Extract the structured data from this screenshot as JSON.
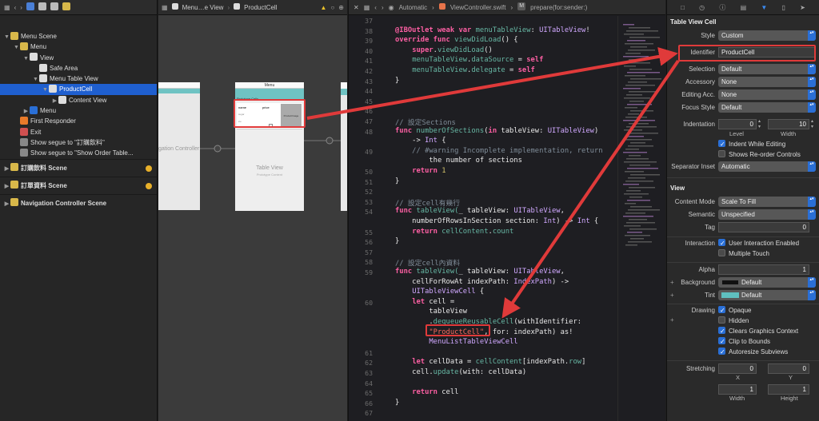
{
  "nav": {
    "tree": [
      {
        "label": "Menu Scene",
        "depth": 0,
        "tri": "▼",
        "icon": "scene-icon"
      },
      {
        "label": "Menu",
        "depth": 1,
        "tri": "▼",
        "icon": "view-controller-icon"
      },
      {
        "label": "View",
        "depth": 2,
        "tri": "▼",
        "icon": "view-icon"
      },
      {
        "label": "Safe Area",
        "depth": 3,
        "tri": "",
        "icon": "safe-area-icon"
      },
      {
        "label": "Menu Table View",
        "depth": 3,
        "tri": "▼",
        "icon": "table-view-icon"
      },
      {
        "label": "ProductCell",
        "depth": 4,
        "tri": "▼",
        "icon": "table-cell-icon",
        "selected": true
      },
      {
        "label": "Content View",
        "depth": 5,
        "tri": "▶",
        "icon": "view-icon"
      },
      {
        "label": "Menu",
        "depth": 2,
        "tri": "▶",
        "icon": "nav-item-icon"
      },
      {
        "label": "First Responder",
        "depth": 1,
        "tri": "",
        "icon": "first-responder-icon"
      },
      {
        "label": "Exit",
        "depth": 1,
        "tri": "",
        "icon": "exit-icon"
      },
      {
        "label": "Show segue to \"訂購飲料\"",
        "depth": 1,
        "tri": "",
        "icon": "segue-icon"
      },
      {
        "label": "Show segue to \"Show Order Table...",
        "depth": 1,
        "tri": "",
        "icon": "segue-icon"
      }
    ],
    "scenes": [
      "訂購飲料 Scene",
      "訂單資料 Scene",
      "Navigation Controller Scene"
    ]
  },
  "jump": {
    "items": [
      "Menu…e View",
      "ProductCell"
    ]
  },
  "canvas": {
    "nav_controller_label": "gation Controller",
    "phone_title": "Menu",
    "prototype_label": "Prototype Cells",
    "cell_name": "name",
    "cell_price": "price",
    "cell_sub1": "sugar",
    "cell_sub2": "ice",
    "cell_image": "ProductImage",
    "table_view_label": "Table View",
    "table_view_sub": "Prototype Content"
  },
  "editor": {
    "breadcrumbs": [
      "Automatic",
      "ViewController.swift",
      "prepare(for:sender:)"
    ],
    "lines": [
      {
        "n": "37",
        "t": ""
      },
      {
        "n": "38",
        "t": "@IBOutlet weak var menuTableView: UITableView!"
      },
      {
        "n": "39",
        "t": "override func viewDidLoad() {"
      },
      {
        "n": "40",
        "t": "    super.viewDidLoad()"
      },
      {
        "n": "41",
        "t": "    menuTableView.dataSource = self"
      },
      {
        "n": "42",
        "t": "    menuTableView.delegate = self"
      },
      {
        "n": "43",
        "t": "}"
      },
      {
        "n": "44",
        "t": ""
      },
      {
        "n": "45",
        "t": ""
      },
      {
        "n": "46",
        "t": ""
      },
      {
        "n": "47",
        "t": "// 設定Sections"
      },
      {
        "n": "48",
        "t": "func numberOfSections(in tableView: UITableView)"
      },
      {
        "n": "",
        "t": "    -> Int {"
      },
      {
        "n": "49",
        "t": "    // #warning Incomplete implementation, return"
      },
      {
        "n": "",
        "t": "        the number of sections"
      },
      {
        "n": "50",
        "t": "    return 1"
      },
      {
        "n": "51",
        "t": "}"
      },
      {
        "n": "52",
        "t": ""
      },
      {
        "n": "53",
        "t": "// 設定cell有幾行"
      },
      {
        "n": "54",
        "t": "func tableView(_ tableView: UITableView,"
      },
      {
        "n": "",
        "t": "    numberOfRowsInSection section: Int) -> Int {"
      },
      {
        "n": "55",
        "t": "    return cellContent.count"
      },
      {
        "n": "56",
        "t": "}"
      },
      {
        "n": "57",
        "t": ""
      },
      {
        "n": "58",
        "t": "// 設定cell內資料"
      },
      {
        "n": "59",
        "t": "func tableView(_ tableView: UITableView,"
      },
      {
        "n": "",
        "t": "    cellForRowAt indexPath: IndexPath) ->"
      },
      {
        "n": "",
        "t": "    UITableViewCell {"
      },
      {
        "n": "60",
        "t": "    let cell ="
      },
      {
        "n": "",
        "t": "        tableView"
      },
      {
        "n": "",
        "t": "        .dequeueReusableCell(withIdentifier:"
      },
      {
        "n": "",
        "t": "        \"ProductCell\", for: indexPath) as!"
      },
      {
        "n": "",
        "t": "        MenuListTableViewCell"
      },
      {
        "n": "61",
        "t": ""
      },
      {
        "n": "62",
        "t": "    let cellData = cellContent[indexPath.row]"
      },
      {
        "n": "63",
        "t": "    cell.update(with: cellData)"
      },
      {
        "n": "64",
        "t": ""
      },
      {
        "n": "65",
        "t": "    return cell"
      },
      {
        "n": "66",
        "t": "}"
      },
      {
        "n": "67",
        "t": ""
      }
    ]
  },
  "inspector": {
    "section_cell": "Table View Cell",
    "style_label": "Style",
    "style_value": "Custom",
    "identifier_label": "Identifier",
    "identifier_value": "ProductCell",
    "selection_label": "Selection",
    "selection_value": "Default",
    "accessory_label": "Accessory",
    "accessory_value": "None",
    "editing_label": "Editing Acc.",
    "editing_value": "None",
    "focus_label": "Focus Style",
    "focus_value": "Default",
    "indent_label": "Indentation",
    "indent_level": "0",
    "indent_width": "10",
    "level_caption": "Level",
    "width_caption": "Width",
    "indent_editing": "Indent While Editing",
    "reorder": "Shows Re-order Controls",
    "sepinset_label": "Separator Inset",
    "sepinset_value": "Automatic",
    "section_view": "View",
    "content_mode_label": "Content Mode",
    "content_mode_value": "Scale To Fill",
    "semantic_label": "Semantic",
    "semantic_value": "Unspecified",
    "tag_label": "Tag",
    "tag_value": "0",
    "interaction_label": "Interaction",
    "user_interaction": "User Interaction Enabled",
    "multi_touch": "Multiple Touch",
    "alpha_label": "Alpha",
    "alpha_value": "1",
    "background_label": "Background",
    "background_value": "Default",
    "tint_label": "Tint",
    "tint_value": "Default",
    "drawing_label": "Drawing",
    "opaque": "Opaque",
    "hidden": "Hidden",
    "clears": "Clears Graphics Context",
    "clip": "Clip to Bounds",
    "autoresize": "Autoresize Subviews",
    "stretching_label": "Stretching",
    "stretch_x": "0",
    "stretch_y": "0",
    "stretch_w": "1",
    "stretch_h": "1",
    "x_caption": "X",
    "y_caption": "Y",
    "w_caption": "Width",
    "h_caption": "Height"
  },
  "colors": {
    "selection": "#1f5fcf",
    "annotation": "#e03a3a",
    "accent": "#2a6fd6",
    "teal": "#5fbfbf"
  }
}
